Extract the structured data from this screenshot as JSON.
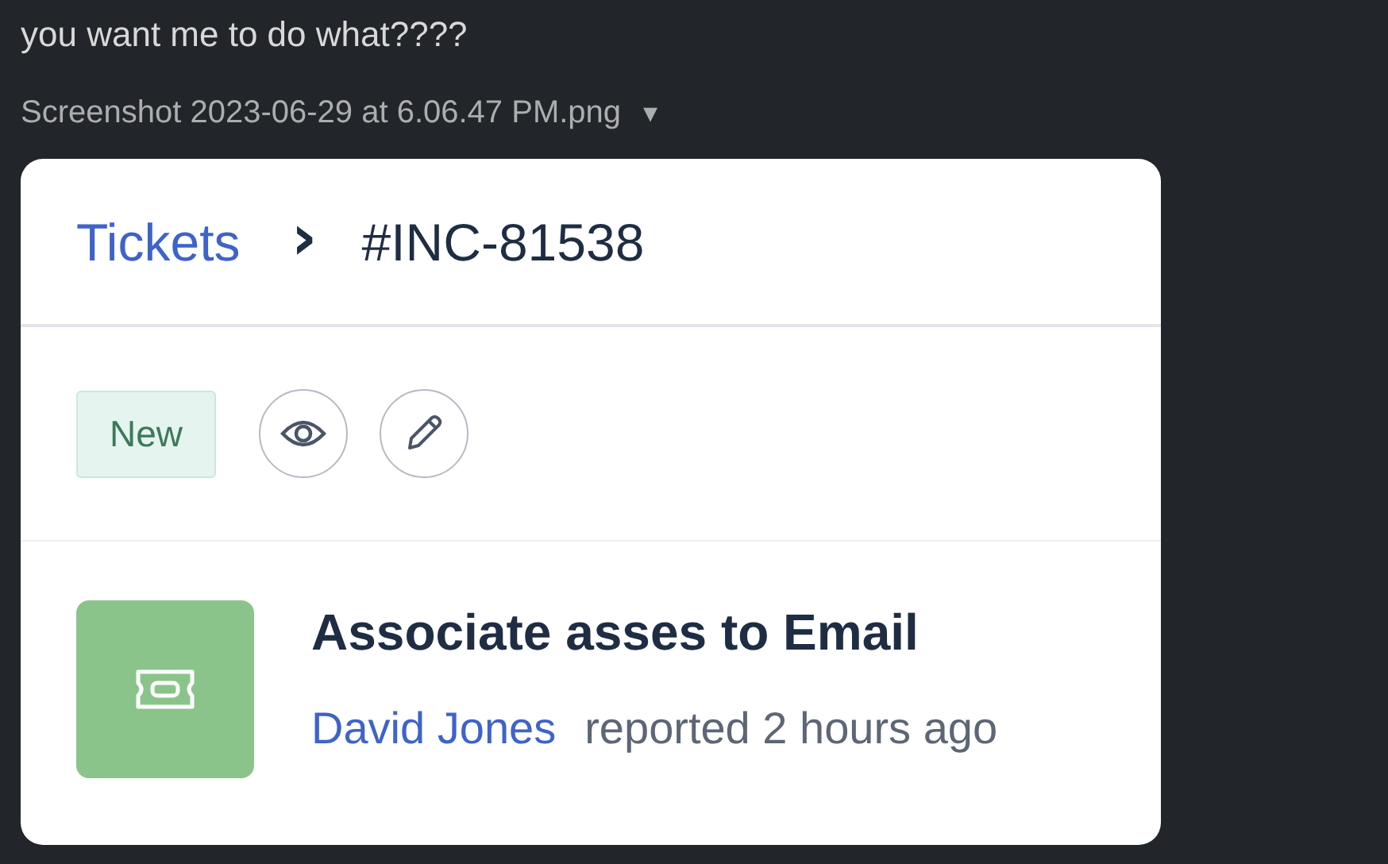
{
  "message": {
    "text": "you want me to do what????"
  },
  "attachment": {
    "filename": "Screenshot 2023-06-29 at 6.06.47 PM.png",
    "caret": "▾"
  },
  "ticket": {
    "breadcrumb": {
      "parent": "Tickets",
      "separator": "›",
      "current": "#INC-81538"
    },
    "status": "New",
    "title": "Associate asses to Email",
    "reporter": "David Jones",
    "reported": "reported 2 hours ago"
  }
}
